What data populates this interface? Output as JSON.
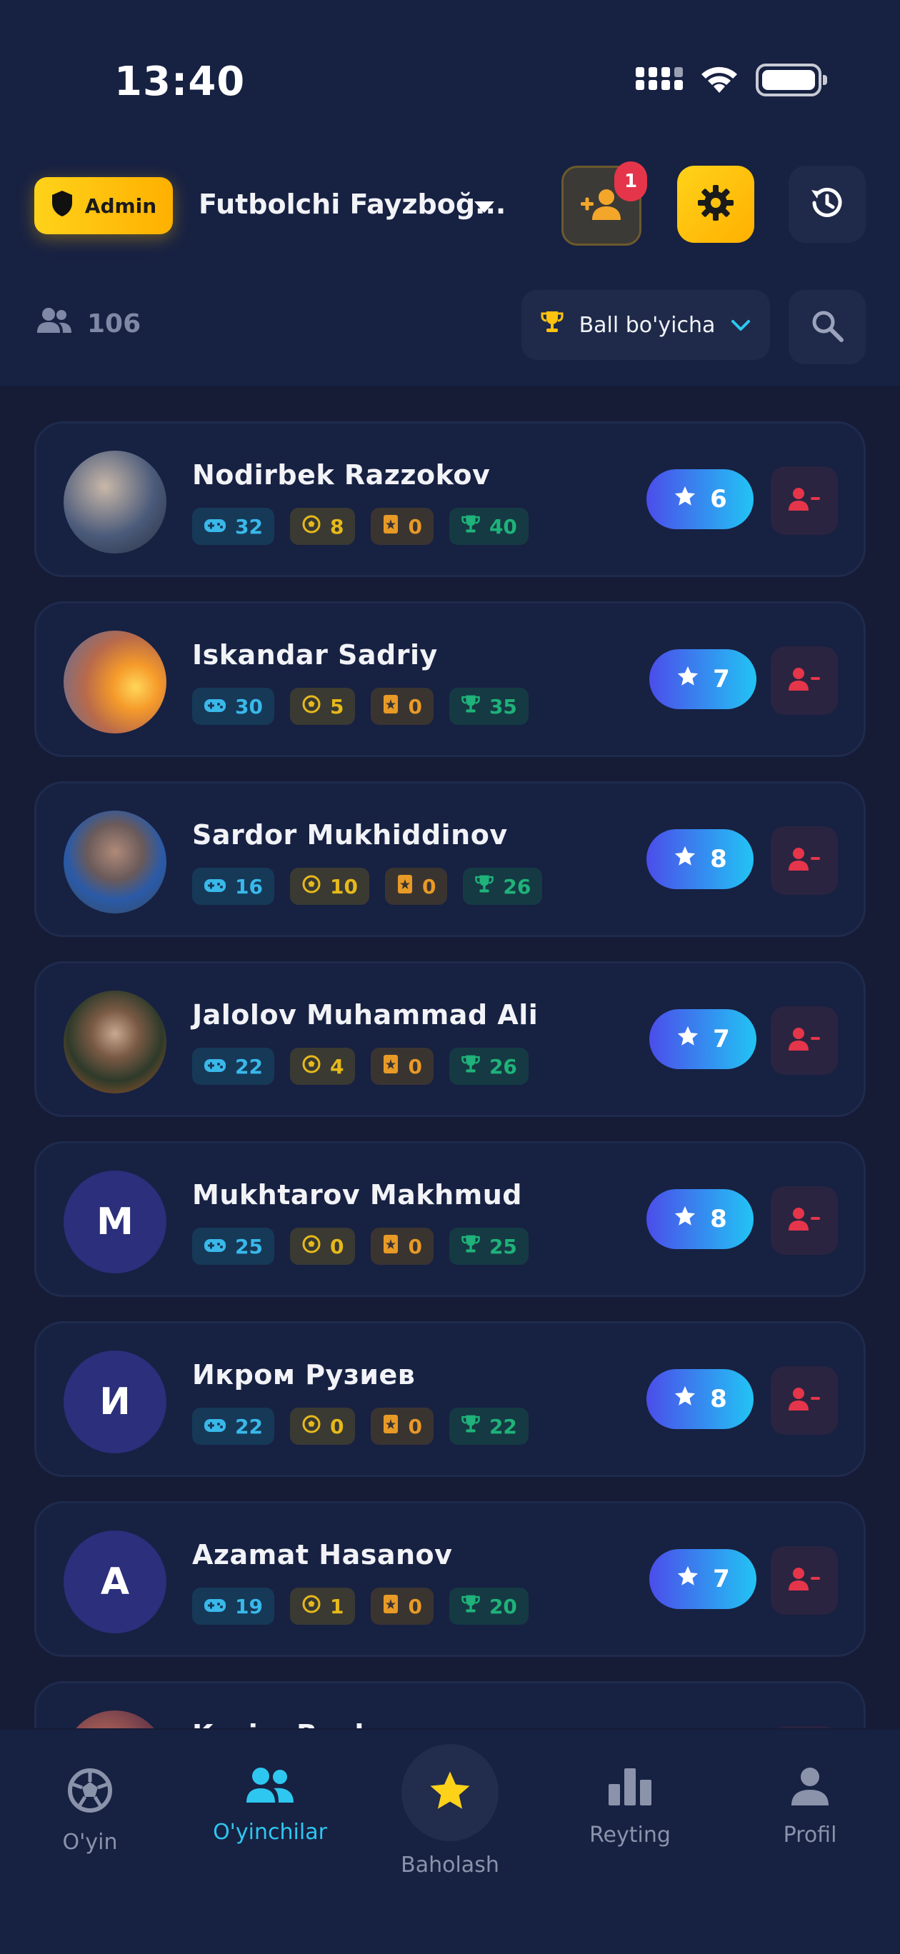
{
  "status_bar": {
    "time": "13:40"
  },
  "header": {
    "admin_label": "Admin",
    "team_name": "Futbolchi Fayzboğ...",
    "notification_count": "1",
    "player_count": "106",
    "sort_label": "Ball bo'yicha"
  },
  "players": [
    {
      "name": "Nodirbek Razzokov",
      "avatar": "photo",
      "games": "32",
      "goals": "8",
      "cards": "0",
      "trophies": "40",
      "rating": "6"
    },
    {
      "name": "Iskandar Sadriy",
      "avatar": "photo",
      "games": "30",
      "goals": "5",
      "cards": "0",
      "trophies": "35",
      "rating": "7"
    },
    {
      "name": "Sardor Mukhiddinov",
      "avatar": "photo",
      "games": "16",
      "goals": "10",
      "cards": "0",
      "trophies": "26",
      "rating": "8"
    },
    {
      "name": "Jalolov Muhammad Ali",
      "avatar": "photo",
      "games": "22",
      "goals": "4",
      "cards": "0",
      "trophies": "26",
      "rating": "7"
    },
    {
      "name": "Mukhtarov Makhmud",
      "avatar": "M",
      "games": "25",
      "goals": "0",
      "cards": "0",
      "trophies": "25",
      "rating": "8"
    },
    {
      "name": "Икром Рузиев",
      "avatar": "И",
      "games": "22",
      "goals": "0",
      "cards": "0",
      "trophies": "22",
      "rating": "8"
    },
    {
      "name": "Azamat Hasanov",
      "avatar": "A",
      "games": "19",
      "goals": "1",
      "cards": "0",
      "trophies": "20",
      "rating": "7"
    },
    {
      "name": "Kazim Boykar",
      "avatar": "photo",
      "games": "",
      "goals": "",
      "cards": "",
      "trophies": "",
      "rating": ""
    }
  ],
  "nav": {
    "game": "O'yin",
    "players": "O'yinchilar",
    "rate": "Baholash",
    "ranking": "Reyting",
    "profile": "Profil"
  },
  "colors": {
    "background": "#161c36",
    "card": "#172142",
    "accent_yellow": "#ffc20e",
    "accent_cyan": "#2ec7f0",
    "danger": "#e5354a"
  }
}
